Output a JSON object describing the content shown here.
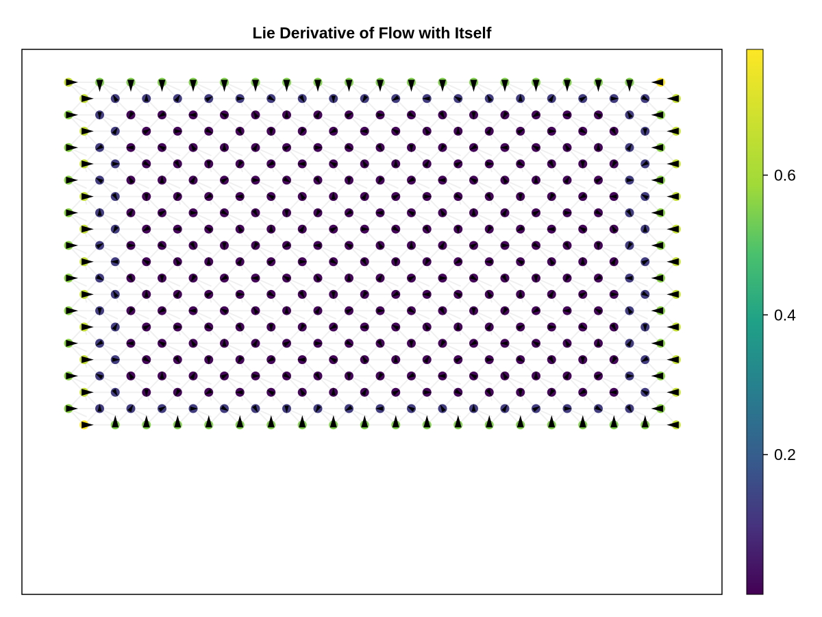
{
  "chart_data": {
    "type": "scatter",
    "title": "Lie Derivative of Flow with Itself",
    "xlabel": "",
    "ylabel": "",
    "grid": false,
    "mesh": {
      "kind": "triangulated hexagonal lattice",
      "columns": 20,
      "rows": 22,
      "edge_color": "#f0f0f0"
    },
    "field": {
      "marker": "triangle arrow",
      "marker_color": "#000000",
      "interior_direction": "varies, near zero magnitude",
      "left_boundary_direction": "right",
      "right_boundary_direction": "left",
      "top_boundary_direction": "down",
      "bottom_boundary_direction": "up"
    },
    "color_values": {
      "interior": 0.01,
      "near_boundary": 0.12,
      "left_boundary": [
        0.56,
        0.66
      ],
      "right_boundary": [
        0.56,
        0.66
      ],
      "top_bottom_boundary": 0.55,
      "corners": 0.78
    },
    "colorbar": {
      "colormap": "viridis",
      "range": [
        0.0,
        0.78
      ],
      "ticks": [
        {
          "value": 0.2,
          "label": "0.2"
        },
        {
          "value": 0.4,
          "label": "0.4"
        },
        {
          "value": 0.6,
          "label": "0.6"
        }
      ]
    }
  }
}
